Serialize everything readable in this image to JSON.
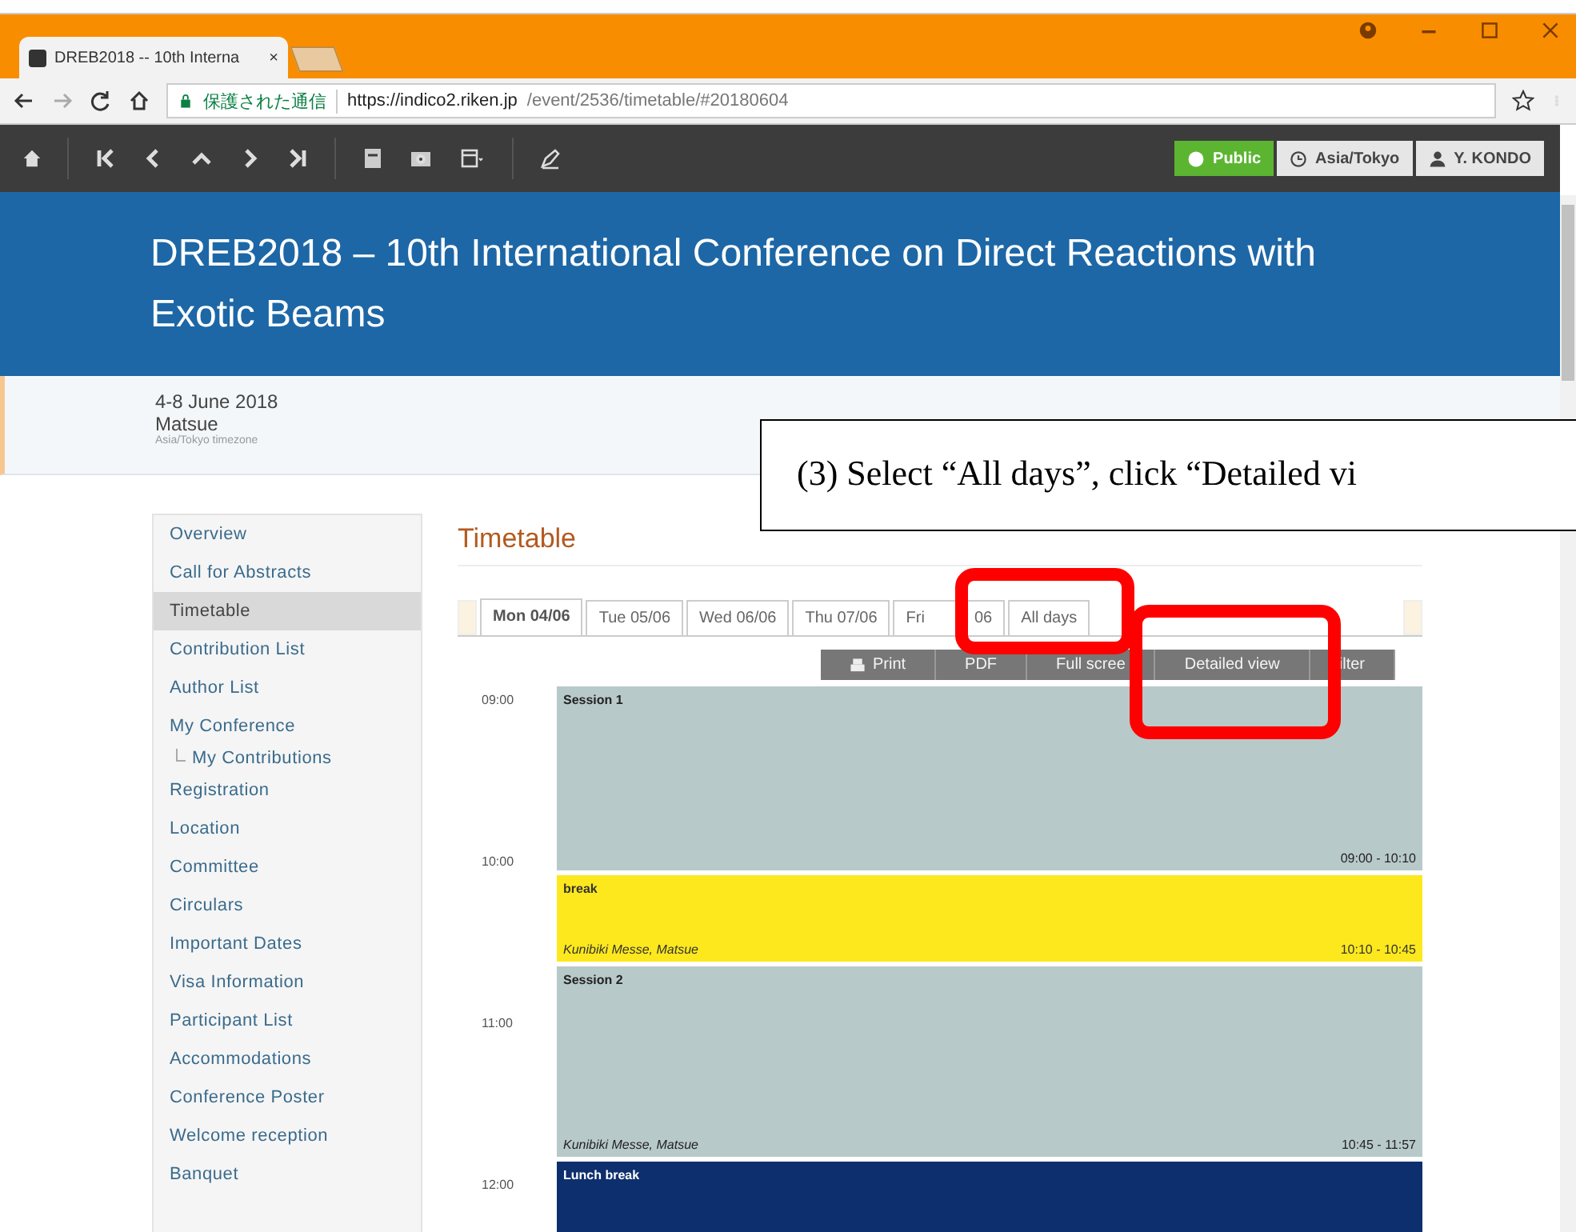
{
  "browser": {
    "tab_title": "DREB2018 -- 10th Interna",
    "tab_close": "×",
    "secure_label": "保護された通信",
    "url_host": "https://indico2.riken.jp",
    "url_path": "/event/2536/timetable/#20180604"
  },
  "toolbar": {
    "public": "Public",
    "timezone": "Asia/Tokyo",
    "user": "Y. KONDO"
  },
  "header": {
    "title": "DREB2018 – 10th International Conference on Direct Reactions with Exotic Beams"
  },
  "info": {
    "dates": "4-8 June 2018",
    "place": "Matsue",
    "timezone": "Asia/Tokyo timezone"
  },
  "callout": "(3) Select “All days”, click “Detailed vi",
  "sidebar": {
    "items": [
      {
        "label": "Overview",
        "selected": false
      },
      {
        "label": "Call for Abstracts",
        "selected": false
      },
      {
        "label": "Timetable",
        "selected": true
      },
      {
        "label": "Contribution List",
        "selected": false
      },
      {
        "label": "Author List",
        "selected": false
      },
      {
        "label": "My Conference",
        "selected": false,
        "children": [
          {
            "label": "My Contributions",
            "selected": false
          }
        ]
      },
      {
        "label": "Registration",
        "selected": false
      },
      {
        "label": "Location",
        "selected": false
      },
      {
        "label": "Committee",
        "selected": false
      },
      {
        "label": "Circulars",
        "selected": false
      },
      {
        "label": "Important Dates",
        "selected": false
      },
      {
        "label": "Visa Information",
        "selected": false
      },
      {
        "label": "Participant List",
        "selected": false
      },
      {
        "label": "Accommodations",
        "selected": false
      },
      {
        "label": "Conference Poster",
        "selected": false
      },
      {
        "label": "Welcome reception",
        "selected": false
      },
      {
        "label": "Banquet",
        "selected": false
      }
    ]
  },
  "timetable": {
    "heading": "Timetable",
    "day_tabs": [
      {
        "label": "Mon 04/06",
        "selected": true
      },
      {
        "label": "Tue 05/06",
        "selected": false
      },
      {
        "label": "Wed 06/06",
        "selected": false
      },
      {
        "label": "Thu 07/06",
        "selected": false
      },
      {
        "label": "Fri",
        "tail": "06",
        "selected": false
      },
      {
        "label": "All days",
        "selected": false
      }
    ],
    "actions": [
      "Print",
      "PDF",
      "Full scree",
      "Detailed view",
      "ilter"
    ],
    "hours": [
      "09:00",
      "10:00",
      "11:00",
      "12:00"
    ],
    "entries": [
      {
        "kind": "session",
        "title": "Session 1",
        "time": "09:00 - 10:10"
      },
      {
        "kind": "break",
        "title": "break",
        "location": "Kunibiki Messe, Matsue",
        "time": "10:10 - 10:45"
      },
      {
        "kind": "session",
        "title": "Session 2",
        "location": "Kunibiki Messe, Matsue",
        "time": "10:45 - 11:57"
      },
      {
        "kind": "lunch",
        "title": "Lunch break"
      }
    ]
  }
}
